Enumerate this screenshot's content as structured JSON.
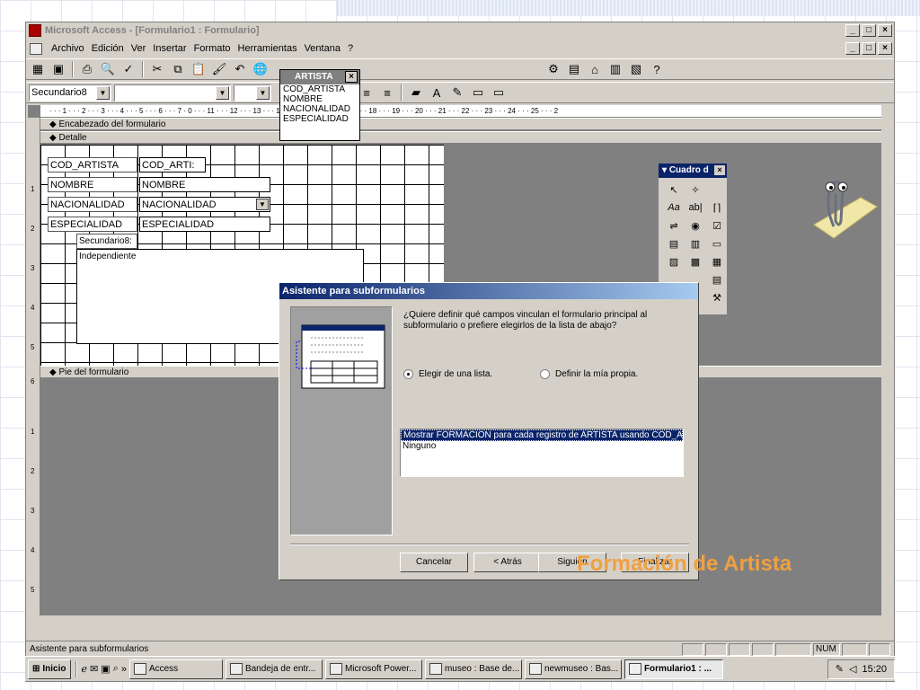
{
  "window": {
    "title": "Microsoft Access - [Formulario1 : Formulario]",
    "min": "_",
    "max": "□",
    "close": "×"
  },
  "menu": [
    "Archivo",
    "Edición",
    "Ver",
    "Insertar",
    "Formato",
    "Herramientas",
    "Ventana",
    "?"
  ],
  "format_toolbar": {
    "object_combo": "Secundario8",
    "font_combo": "",
    "size_combo": ""
  },
  "ruler": "· · · 1 · · · 2 · · · 3 · · · 4 · · · 5 · · · 6 · · · 7 ·                          0 · · · 11 · · · 12 · · · 13 · · · 14 · · · 15 · · · 16 · · · 17 · · · 18 · · · 19 · · · 20 · · · 21 · · · 22 · · · 23 · · · 24 · · · 25 · · · 2",
  "sections": {
    "header": "Encabezado del formulario",
    "detail": "Detalle",
    "footer": "Pie del formulario"
  },
  "fields": [
    {
      "label": "COD_ARTISTA",
      "control": "COD_ARTI:"
    },
    {
      "label": "NOMBRE",
      "control": "NOMBRE"
    },
    {
      "label": "NACIONALIDAD",
      "control": "NACIONALIDAD"
    },
    {
      "label": "ESPECIALIDAD",
      "control": "ESPECIALIDAD"
    }
  ],
  "subform": {
    "label": "Secundario8:",
    "content": "Independiente"
  },
  "field_list": {
    "title": "ARTISTA",
    "items": [
      "COD_ARTISTA",
      "NOMBRE",
      "NACIONALIDAD",
      "ESPECIALIDAD"
    ]
  },
  "toolbox": {
    "title": "Cuadro d"
  },
  "wizard": {
    "title": "Asistente para subformularios",
    "question": "¿Quiere definir qué campos vinculan el formulario principal al subformulario o prefiere elegirlos de la lista de abajo?",
    "option1": "Elegir de una lista.",
    "option2": "Definir la mía propia.",
    "list": [
      "Mostrar FORMACION para cada registro de ARTISTA usando COD_A",
      "Ninguno"
    ],
    "cancel": "Cancelar",
    "back": "< Atrás",
    "next": "Siguien",
    "finish": "Finalizar"
  },
  "status": {
    "text": "Asistente para subformularios",
    "num": "NUM"
  },
  "taskbar": {
    "start": "Inicio",
    "tasks": [
      "Access",
      "Bandeja de entr...",
      "Microsoft Power...",
      "museo : Base de...",
      "newmuseo : Bas...",
      "Formulario1 : ..."
    ],
    "clock": "15:20"
  },
  "caption": "Formación de Artista",
  "colors": {
    "title_active": "#0a246a",
    "caption": "#f0a040",
    "chrome": "#d4d0c8"
  }
}
